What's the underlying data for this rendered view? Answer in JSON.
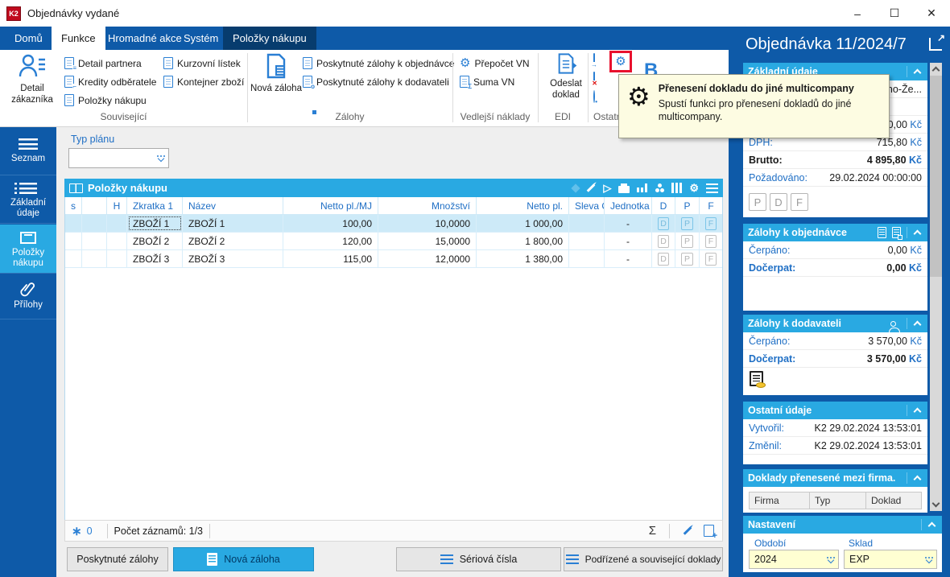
{
  "window": {
    "title": "Objednávky vydané",
    "logo": "K2",
    "controls": {
      "minimize": "–",
      "maximize": "☐",
      "close": "✕"
    }
  },
  "tabs": {
    "domu": "Domů",
    "funkce": "Funkce",
    "hromadne": "Hromadné akce",
    "system": "Systém",
    "polozky": "Položky nákupu"
  },
  "ribbon": {
    "detail_zakaznika": "Detail zákazníka",
    "detail_partnera": "Detail partnera",
    "kredity": "Kredity odběratele",
    "polozky_nakupu": "Položky nákupu",
    "kurzovni": "Kurzovní lístek",
    "kontejner": "Kontejner zboží",
    "group_souvisejici": "Související",
    "nova_zaloha": "Nová záloha",
    "zalohy_k_objednavce": "Poskytnuté zálohy k objednávce",
    "zalohy_k_dodavateli": "Poskytnuté zálohy k dodavateli",
    "group_zalohy": "Zálohy",
    "prepocet_vn": "Přepočet VN",
    "suma_vn": "Suma VN",
    "group_vedlejsi": "Vedlejší náklady",
    "odeslat_doklad": "Odeslat doklad",
    "group_edi": "EDI",
    "group_ostatni": "Ostatní",
    "partial_big_letter": "B"
  },
  "tooltip": {
    "title": "Přenesení dokladu do jiné multicompany",
    "body": "Spustí funkci pro přenesení dokladů do jiné multicompany."
  },
  "sidebar": {
    "seznam": "Seznam",
    "zakladni_udaje": "Základní údaje",
    "polozky_nakupu": "Položky nákupu",
    "prilohy": "Přílohy"
  },
  "filter": {
    "label": "Typ plánu"
  },
  "grid": {
    "title": "Položky nákupu",
    "columns": {
      "s": "s",
      "h": "H",
      "zkratka": "Zkratka 1",
      "nazev": "Název",
      "netto_mj": "Netto pl./MJ",
      "mnozstvi": "Množství",
      "netto": "Netto pl.",
      "sleva": "Sleva O",
      "jednotka": "Jednotka",
      "d": "D",
      "p": "P",
      "f": "F"
    },
    "rows": [
      {
        "zkratka": "ZBOŽÍ 1",
        "nazev": "ZBOŽÍ 1",
        "netto_mj": "100,00",
        "mnozstvi": "10,0000",
        "netto": "1 000,00",
        "jednotka": "-",
        "d": "D",
        "p": "P",
        "f": "F"
      },
      {
        "zkratka": "ZBOŽÍ 2",
        "nazev": "ZBOŽÍ 2",
        "netto_mj": "120,00",
        "mnozstvi": "15,0000",
        "netto": "1 800,00",
        "jednotka": "-",
        "d": "D",
        "p": "P",
        "f": "F"
      },
      {
        "zkratka": "ZBOŽÍ 3",
        "nazev": "ZBOŽÍ 3",
        "netto_mj": "115,00",
        "mnozstvi": "12,0000",
        "netto": "1 380,00",
        "jednotka": "-",
        "d": "D",
        "p": "P",
        "f": "F"
      }
    ]
  },
  "statusbar": {
    "flag_count": "0",
    "records": "Počet záznamů: 1/3"
  },
  "footer": {
    "poskytnute_zalohy": "Poskytnuté zálohy",
    "nova_zaloha": "Nová záloha",
    "seriova_cisla": "Sériová čísla",
    "podrizene": "Podřízené a související doklady"
  },
  "panel": {
    "title": "Objednávka 11/2024/7",
    "currency": "Kč",
    "zakladni": {
      "title": "Základní údaje",
      "partial_address": "rno-Že...",
      "partial_netto": "80,00",
      "dph_label": "DPH:",
      "dph_value": "715,80",
      "brutto_label": "Brutto:",
      "brutto_value": "4 895,80",
      "pozadovano_label": "Požadováno:",
      "pozadovano_value": "29.02.2024 00:00:00",
      "flags": [
        "P",
        "D",
        "F"
      ]
    },
    "zalohy_obj": {
      "title": "Zálohy k objednávce",
      "cerpano_label": "Čerpáno:",
      "cerpano_value": "0,00",
      "docerpat_label": "Dočerpat:",
      "docerpat_value": "0,00"
    },
    "zalohy_dod": {
      "title": "Zálohy k dodavateli",
      "cerpano_label": "Čerpáno:",
      "cerpano_value": "3 570,00",
      "docerpat_label": "Dočerpat:",
      "docerpat_value": "3 570,00"
    },
    "ostatni": {
      "title": "Ostatní údaje",
      "vytvoril_label": "Vytvořil:",
      "vytvoril_value": "K2 29.02.2024 13:53:01",
      "zmenil_label": "Změnil:",
      "zmenil_value": "K2 29.02.2024 13:53:01"
    },
    "doklady": {
      "title": "Doklady přenesené mezi firma...",
      "col_firma": "Firma",
      "col_typ": "Typ",
      "col_doklad": "Doklad"
    },
    "nastaveni": {
      "title": "Nastavení",
      "obdobi_label": "Období",
      "obdobi_value": "2024",
      "sklad_label": "Sklad",
      "sklad_value": "EXP"
    }
  }
}
